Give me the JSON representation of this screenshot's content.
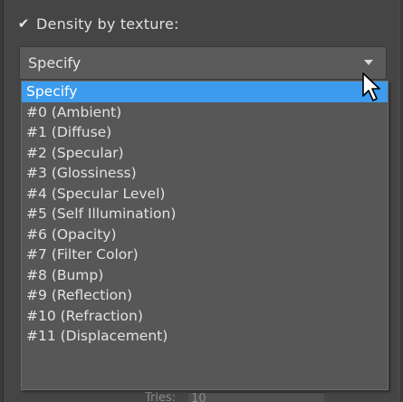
{
  "density": {
    "checkbox_glyph": "✔",
    "label": "Density by texture:",
    "checked": true
  },
  "combo": {
    "value": "Specify",
    "expanded": true,
    "arrow_icon": "chevron-down-icon"
  },
  "dropdown": {
    "items": [
      "Specify",
      "#0 (Ambient)",
      "#1 (Diffuse)",
      "#2 (Specular)",
      "#3 (Glossiness)",
      "#4 (Specular Level)",
      "#5 (Self Illumination)",
      "#6 (Opacity)",
      "#7 (Filter Color)",
      "#8 (Bump)",
      "#9 (Reflection)",
      "#10 (Refraction)",
      "#11 (Displacement)"
    ],
    "selected_index": 0
  },
  "tries": {
    "label": "Tries:",
    "value": "10"
  },
  "colors": {
    "selection": "#3c9bec",
    "panel": "#454545",
    "dropdown_bg": "#575757"
  },
  "cursor_icon": "mouse-pointer-icon"
}
